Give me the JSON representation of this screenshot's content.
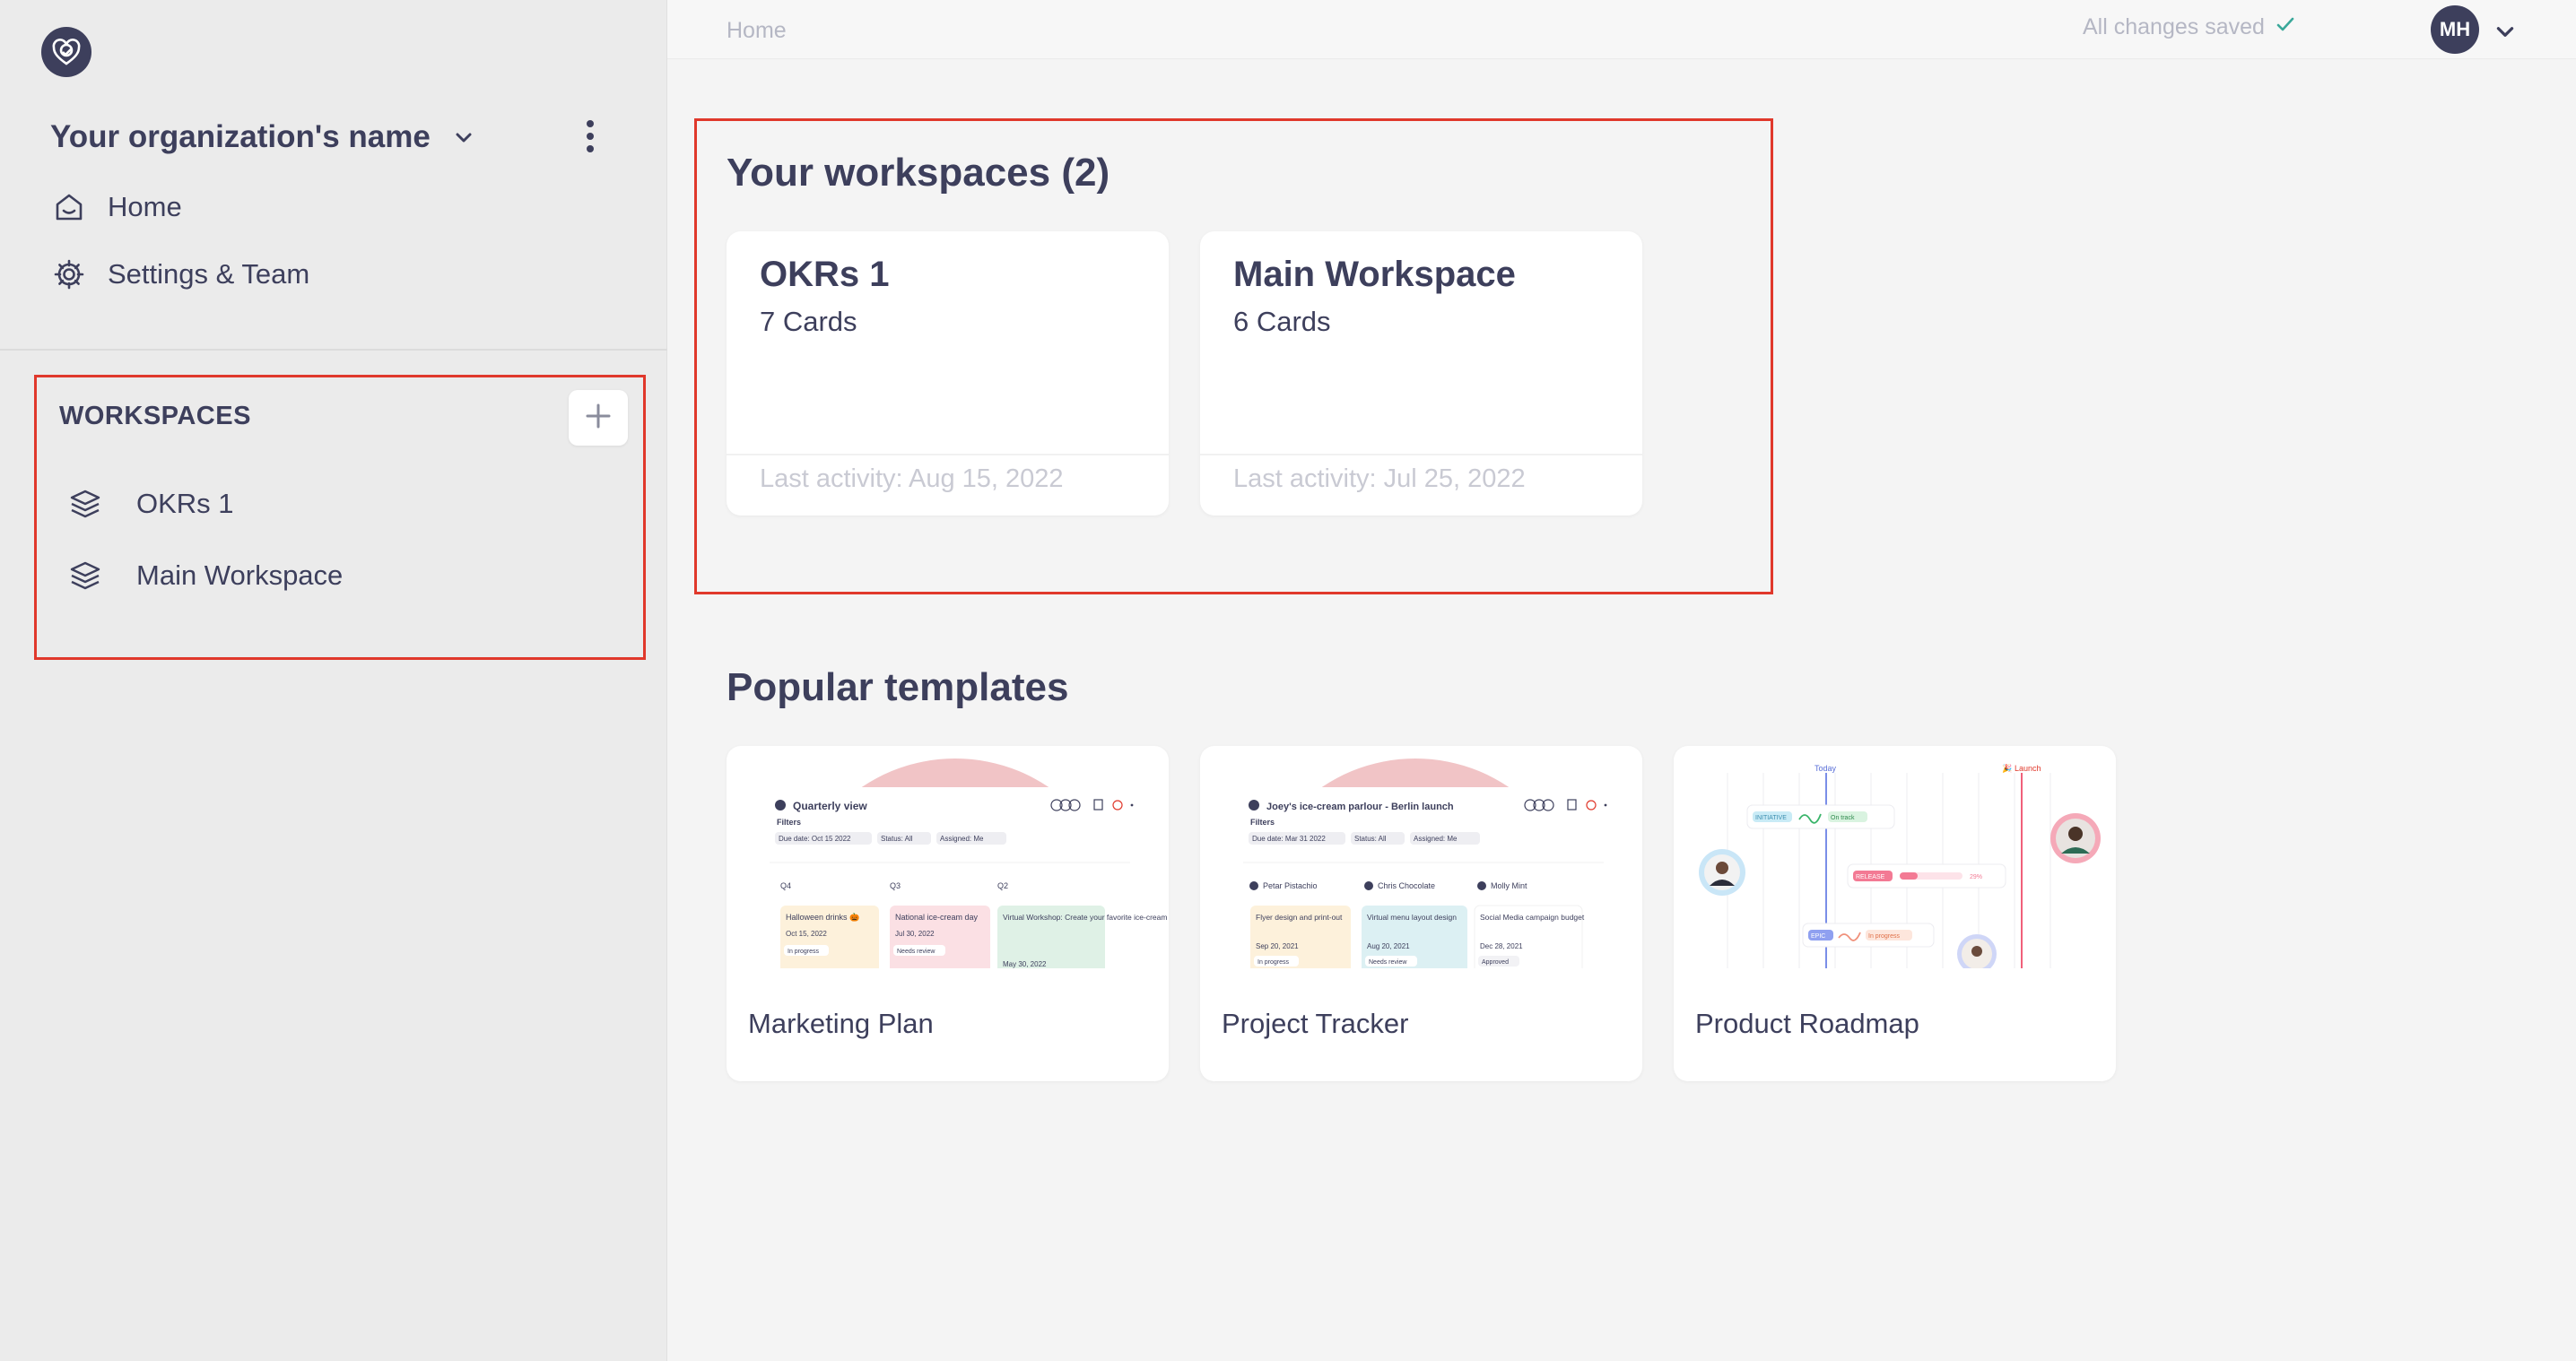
{
  "sidebar": {
    "org_name": "Your organization's name",
    "nav": [
      {
        "label": "Home",
        "icon": "home-icon"
      },
      {
        "label": "Settings & Team",
        "icon": "gear-icon"
      }
    ],
    "workspaces_header": "WORKSPACES",
    "workspaces": [
      {
        "label": "OKRs 1",
        "icon": "layers-icon"
      },
      {
        "label": "Main Workspace",
        "icon": "layers-icon"
      }
    ]
  },
  "topbar": {
    "breadcrumb": "Home",
    "saved_status": "All changes saved",
    "avatar_initials": "MH"
  },
  "main": {
    "workspaces_title": "Your workspaces (2)",
    "workspace_cards": [
      {
        "title": "OKRs 1",
        "count": "7 Cards",
        "activity": "Last activity: Aug 15, 2022"
      },
      {
        "title": "Main Workspace",
        "count": "6 Cards",
        "activity": "Last activity: Jul 25, 2022"
      }
    ],
    "templates_title": "Popular templates",
    "templates": [
      {
        "name": "Marketing Plan",
        "preview": {
          "board_title": "Quarterly view",
          "filters": "Filters",
          "due_date": "Due date: Oct 15 2022",
          "status": "Status: All",
          "assigned": "Assigned: Me",
          "columns": [
            "Q4",
            "Q3",
            "Q2"
          ],
          "cards": [
            {
              "title": "Halloween drinks 🎃",
              "date": "Oct 15, 2022",
              "tag": "In progress"
            },
            {
              "title": "National ice-cream day",
              "date": "Jul 30, 2022",
              "tag": "Needs review"
            },
            {
              "title": "Virtual Workshop: Create your favorite ice-cream at home",
              "date": "May 30, 2022",
              "tag": ""
            }
          ]
        }
      },
      {
        "name": "Project Tracker",
        "preview": {
          "board_title": "Joey's ice-cream parlour - Berlin launch",
          "filters": "Filters",
          "due_date": "Due date: Mar 31 2022",
          "status": "Status: All",
          "assigned": "Assigned: Me",
          "columns": [
            "Petar Pistachio",
            "Chris Chocolate",
            "Molly Mint"
          ],
          "cards": [
            {
              "title": "Flyer design and print-out",
              "date": "Sep 20, 2021",
              "tag": "In progress"
            },
            {
              "title": "Virtual menu layout design",
              "date": "Aug 20, 2021",
              "tag": "Needs review"
            },
            {
              "title": "Social Media campaign budget",
              "date": "Dec 28, 2021",
              "tag": "Approved"
            }
          ]
        }
      },
      {
        "name": "Product Roadmap",
        "preview": {
          "today_label": "Today",
          "launch_label": "Launch",
          "tags": [
            "INITIATIVE",
            "On track",
            "RELEASE",
            "29%",
            "EPIC",
            "In progress"
          ]
        }
      }
    ]
  },
  "colors": {
    "accent_dark": "#3d3f5c",
    "highlight_box": "#e0382b",
    "muted_text": "#b5b7c4",
    "saved_check": "#3aa89a"
  }
}
